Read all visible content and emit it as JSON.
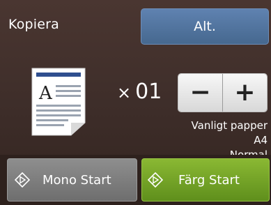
{
  "header": {
    "title": "Kopiera",
    "options_label": "Alt."
  },
  "copies": {
    "prefix": "×",
    "count": "01",
    "minus_label": "−",
    "plus_label": "+"
  },
  "settings": {
    "paper_type": "Vanligt papper",
    "paper_size": "A4",
    "quality": "Normal"
  },
  "actions": {
    "mono_start": "Mono Start",
    "color_start": "Färg Start"
  },
  "icons": {
    "document": "document-preview-icon",
    "start": "start-diamond-icon"
  },
  "colors": {
    "background": "#3d2d29",
    "options_button": "#5578a3",
    "mono_button": "#7e7e7e",
    "color_button": "#76a528"
  }
}
